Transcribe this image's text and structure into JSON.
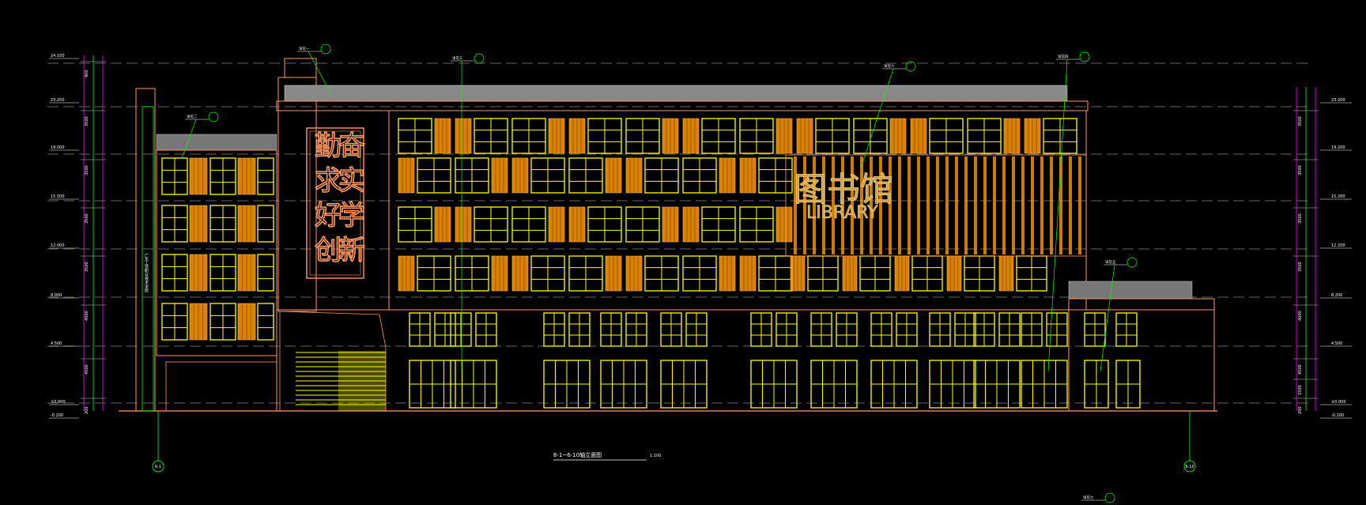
{
  "drawing_title": "6-1~6-10轴立面图",
  "scale_label": "1:100",
  "signage": {
    "motto_chars": [
      "勤",
      "奋",
      "求",
      "实",
      "好",
      "学",
      "创",
      "新"
    ],
    "library_cn": "图书馆",
    "library_en": "LIBRARY",
    "school_name_vertical": "广东工贸职业技术学院"
  },
  "axis_bubbles": {
    "left": "6-1",
    "right": "6-10"
  },
  "callouts": [
    "详见一",
    "详见二",
    "详见三",
    "详见四",
    "详见五",
    "详见六",
    "详见七"
  ],
  "left_elevations": [
    "24.100",
    "23.200",
    "19.000",
    "15.500",
    "12.000",
    "8.000",
    "4.500",
    "±0.000",
    "-0.200"
  ],
  "right_elevations": [
    "23.200",
    "19.200",
    "15.200",
    "12.200",
    "8.200",
    "4.500",
    "±0.000",
    "-0.200"
  ],
  "left_dims": [
    "900",
    "3500",
    "3500",
    "3500",
    "3500",
    "4000",
    "4500",
    "200"
  ],
  "right_dims": [
    "3500",
    "3500",
    "3500",
    "3500",
    "4000",
    "4500",
    "1500",
    "200"
  ],
  "colors": {
    "frame": "#ff9966",
    "window": "#ffff00",
    "panel": "#ff9900",
    "dim_line": "#ff00ff",
    "leader": "#00ff00",
    "axis": "#00ff00"
  }
}
